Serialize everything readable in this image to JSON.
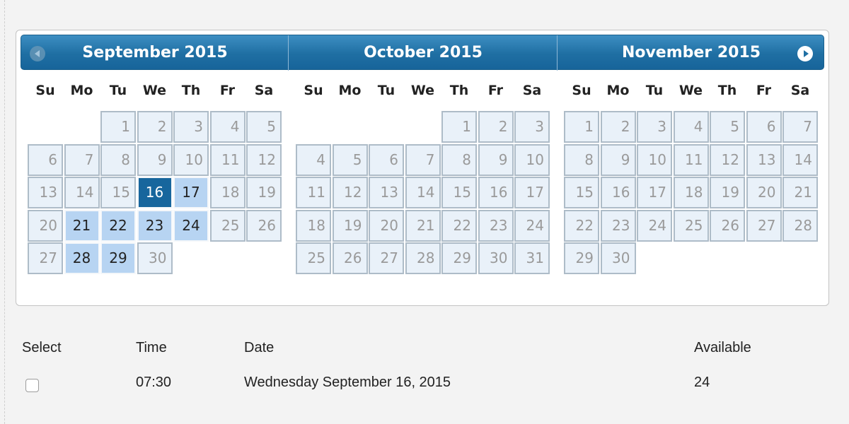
{
  "calendar": {
    "months": [
      {
        "title": "September 2015",
        "start": 2,
        "days": 30,
        "current": 16,
        "selected": [
          17,
          21,
          22,
          23,
          24,
          28,
          29
        ]
      },
      {
        "title": "October 2015",
        "start": 4,
        "days": 31,
        "current": null,
        "selected": []
      },
      {
        "title": "November 2015",
        "start": 0,
        "days": 30,
        "current": null,
        "selected": []
      }
    ],
    "weekdays": [
      "Su",
      "Mo",
      "Tu",
      "We",
      "Th",
      "Fr",
      "Sa"
    ],
    "prev_icon": "chevron-left-icon",
    "next_icon": "chevron-right-icon",
    "colors": {
      "header": "#1f6fa3",
      "current_day": "#17669d",
      "selected_day": "#b7d4f2",
      "day_cell": "#e9f1f9"
    }
  },
  "table": {
    "headers": {
      "select": "Select",
      "time": "Time",
      "date": "Date",
      "available": "Available"
    },
    "rows": [
      {
        "time": "07:30",
        "date": "Wednesday September 16, 2015",
        "available": "24",
        "checked": false
      }
    ]
  }
}
